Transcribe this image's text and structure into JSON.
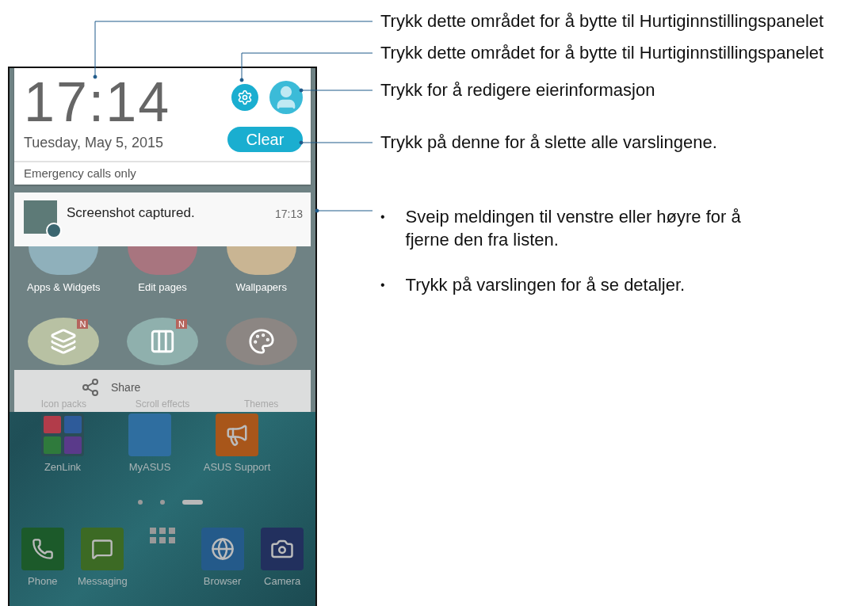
{
  "callouts": [
    {
      "text": "Trykk dette området for å bytte til Hurtiginnstillingspanelet"
    },
    {
      "text": "Trykk dette området for å bytte til Hurtiginnstillingspanelet"
    },
    {
      "text": "Trykk for å redigere eierinformasjon"
    },
    {
      "text": "Trykk på denne for å slette alle varslingene."
    }
  ],
  "bullets": [
    {
      "kind": "leader",
      "mark": "•",
      "text": "Sveip meldingen til venstre eller høyre for å fjerne den fra listen."
    },
    {
      "kind": "plain",
      "mark": "•",
      "text": "Trykk på varslingen for å se detaljer."
    }
  ],
  "quick_settings": {
    "time": "17:14",
    "date": "Tuesday, May 5, 2015",
    "clear_button": "Clear",
    "status": "Emergency calls only"
  },
  "notification": {
    "title": "Screenshot captured.",
    "time": "17:13"
  },
  "edit_menu": {
    "items": [
      {
        "label": "Apps & Widgets",
        "color": "#8fb0bb"
      },
      {
        "label": "Edit pages",
        "color": "#a8757f"
      },
      {
        "label": "Wallpapers",
        "color": "#c9b593"
      },
      {
        "label": "Icon packs",
        "color": "#b8c1a3",
        "badge": "N"
      },
      {
        "label": "Scroll effects",
        "color": "#8fb0ad",
        "badge": "N"
      },
      {
        "label": "Themes",
        "color": "#8c8683"
      }
    ],
    "share": "Share"
  },
  "home_apps": [
    {
      "kind": "folder",
      "label": "ZenLink"
    },
    {
      "kind": "logo",
      "label": "MyASUS"
    },
    {
      "kind": "support",
      "label": "ASUS Support"
    }
  ],
  "page_dots": [
    {
      "selected": false
    },
    {
      "selected": false
    },
    {
      "selected": true
    }
  ],
  "dock": [
    {
      "kind": "phone",
      "label": "Phone"
    },
    {
      "kind": "messaging",
      "label": "Messaging"
    },
    {
      "kind": "drawer"
    },
    {
      "kind": "browser",
      "label": "Browser"
    },
    {
      "kind": "camera",
      "label": "Camera"
    }
  ]
}
